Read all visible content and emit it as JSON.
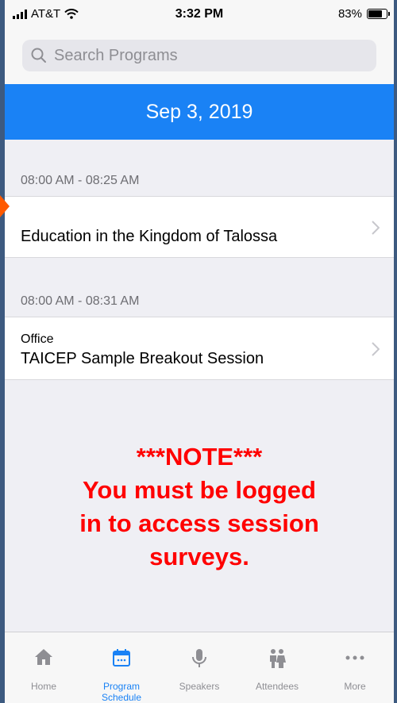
{
  "status_bar": {
    "carrier": "AT&T",
    "time": "3:32 PM",
    "battery_percent": "83%",
    "battery_level": 0.83
  },
  "search": {
    "placeholder": "Search Programs"
  },
  "date": "Sep 3, 2019",
  "sessions": [
    {
      "time_range": "08:00 AM - 08:25 AM",
      "location": "",
      "title": "Education in the Kingdom of Talossa"
    },
    {
      "time_range": "08:00 AM - 08:31 AM",
      "location": "Office",
      "title": "TAICEP Sample Breakout Session"
    }
  ],
  "note": {
    "line1": "***NOTE***",
    "line2": "You must be logged",
    "line3": "in to access session",
    "line4": "surveys."
  },
  "tabs": [
    {
      "label": "Home",
      "icon": "home-icon",
      "active": false
    },
    {
      "label": "Program Schedule",
      "icon": "calendar-icon",
      "active": true
    },
    {
      "label": "Speakers",
      "icon": "microphone-icon",
      "active": false
    },
    {
      "label": "Attendees",
      "icon": "people-icon",
      "active": false
    },
    {
      "label": "More",
      "icon": "more-icon",
      "active": false
    }
  ],
  "colors": {
    "accent": "#1a82f5",
    "note": "#ff0000",
    "pointer": "#ff5a00"
  }
}
